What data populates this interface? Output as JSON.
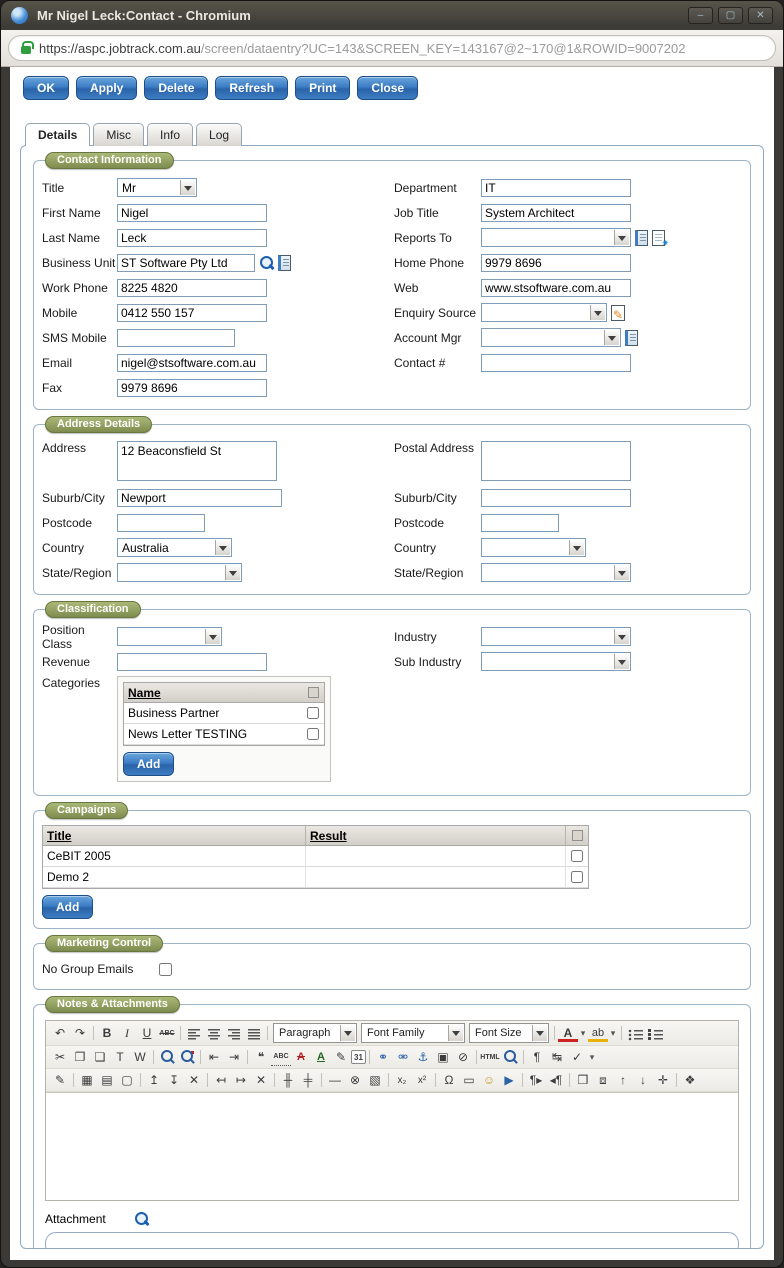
{
  "colors": {
    "button_blue": "#2f6cb0",
    "legend_green": "#7d8c4f",
    "padlock_green": "#2e9e3f",
    "icon_blue": "#1b5fae"
  },
  "titlebar": {
    "title": "Mr Nigel Leck:Contact - Chromium",
    "controls": {
      "minimize": "–",
      "maximize": "▢",
      "close": "✕"
    }
  },
  "urlbar": {
    "host": "https://aspc.jobtrack.com.au",
    "path": "/screen/dataentry?UC=143&SCREEN_KEY=143167@2~170@1&ROWID=9007202"
  },
  "actions": [
    "OK",
    "Apply",
    "Delete",
    "Refresh",
    "Print",
    "Close"
  ],
  "tabs": [
    "Details",
    "Misc",
    "Info",
    "Log"
  ],
  "contact": {
    "legend": "Contact Information",
    "left": [
      {
        "label": "Title",
        "value": "Mr"
      },
      {
        "label": "First Name",
        "value": "Nigel"
      },
      {
        "label": "Last Name",
        "value": "Leck"
      },
      {
        "label": "Business Unit",
        "value": "ST Software Pty Ltd",
        "icons": [
          "search",
          "ledger"
        ]
      },
      {
        "label": "Work Phone",
        "value": "8225 4820"
      },
      {
        "label": "Mobile",
        "value": "0412 550 157"
      },
      {
        "label": "SMS Mobile",
        "value": ""
      },
      {
        "label": "Email",
        "value": "nigel@stsoftware.com.au"
      },
      {
        "label": "Fax",
        "value": "9979 8696"
      }
    ],
    "right": [
      {
        "label": "Department",
        "value": "IT"
      },
      {
        "label": "Job Title",
        "value": "System Architect"
      },
      {
        "label": "Reports To",
        "value": "",
        "icons": [
          "ledger",
          "new-record"
        ]
      },
      {
        "label": "Home Phone",
        "value": "9979 8696"
      },
      {
        "label": "Web",
        "value": "www.stsoftware.com.au"
      },
      {
        "label": "Enquiry Source",
        "value": "",
        "icons": [
          "edit"
        ]
      },
      {
        "label": "Account Mgr",
        "value": "",
        "icons": [
          "ledger"
        ]
      },
      {
        "label": "Contact #",
        "value": ""
      }
    ]
  },
  "address": {
    "legend": "Address Details",
    "left": [
      {
        "label": "Address",
        "value": "12 Beaconsfield St"
      },
      {
        "label": "Suburb/City",
        "value": "Newport"
      },
      {
        "label": "Postcode",
        "value": ""
      },
      {
        "label": "Country",
        "value": "Australia"
      },
      {
        "label": "State/Region",
        "value": ""
      }
    ],
    "right": [
      {
        "label": "Postal Address",
        "value": ""
      },
      {
        "label": "Suburb/City",
        "value": ""
      },
      {
        "label": "Postcode",
        "value": ""
      },
      {
        "label": "Country",
        "value": ""
      },
      {
        "label": "State/Region",
        "value": ""
      }
    ]
  },
  "classification": {
    "legend": "Classification",
    "position_class": {
      "label": "Position Class",
      "value": ""
    },
    "revenue": {
      "label": "Revenue",
      "value": ""
    },
    "industry": {
      "label": "Industry",
      "value": ""
    },
    "sub_industry": {
      "label": "Sub Industry",
      "value": ""
    },
    "categories": {
      "label": "Categories",
      "column": "Name",
      "rows": [
        "Business Partner",
        "News Letter TESTING"
      ],
      "add_label": "Add"
    }
  },
  "campaigns": {
    "legend": "Campaigns",
    "columns": {
      "title": "Title",
      "result": "Result"
    },
    "rows": [
      {
        "title": "CeBIT 2005",
        "result": ""
      },
      {
        "title": "Demo 2",
        "result": ""
      }
    ],
    "add_label": "Add"
  },
  "marketing": {
    "legend": "Marketing Control",
    "no_group_emails_label": "No Group Emails"
  },
  "notes": {
    "legend": "Notes & Attachments",
    "attachment_label": "Attachment",
    "selects": {
      "format": "Paragraph",
      "font_family": "Font Family",
      "font_size": "Font Size"
    },
    "toolbar_row1a": [
      {
        "name": "undo-icon",
        "glyph": "↶"
      },
      {
        "name": "redo-icon",
        "glyph": "↷"
      },
      {
        "name": "toolbar-separator",
        "glyph": ""
      },
      {
        "name": "bold-icon",
        "glyph": "B"
      },
      {
        "name": "italic-icon",
        "glyph": "I"
      },
      {
        "name": "underline-icon",
        "glyph": "U"
      },
      {
        "name": "strikethrough-icon",
        "glyph": "ABC"
      },
      {
        "name": "toolbar-separator",
        "glyph": ""
      },
      {
        "name": "align-left-icon",
        "glyph": ""
      },
      {
        "name": "align-center-icon",
        "glyph": ""
      },
      {
        "name": "align-right-icon",
        "glyph": ""
      },
      {
        "name": "align-justify-icon",
        "glyph": ""
      },
      {
        "name": "toolbar-separator",
        "glyph": ""
      }
    ],
    "toolbar_row1b": [
      {
        "name": "toolbar-separator",
        "glyph": ""
      },
      {
        "name": "forecolor-icon",
        "glyph": "A"
      },
      {
        "name": "forecolor-menu-icon",
        "glyph": "▾"
      },
      {
        "name": "backcolor-icon",
        "glyph": "ab"
      },
      {
        "name": "backcolor-menu-icon",
        "glyph": "▾"
      },
      {
        "name": "toolbar-separator",
        "glyph": ""
      },
      {
        "name": "unordered-list-icon",
        "glyph": ""
      },
      {
        "name": "ordered-list-icon",
        "glyph": ""
      }
    ],
    "toolbar_row2": [
      {
        "name": "cut-icon",
        "glyph": "✂"
      },
      {
        "name": "copy-icon",
        "glyph": "❐"
      },
      {
        "name": "paste-icon",
        "glyph": "❏"
      },
      {
        "name": "paste-as-text-icon",
        "glyph": "T"
      },
      {
        "name": "paste-from-word-icon",
        "glyph": "W"
      },
      {
        "name": "toolbar-separator",
        "glyph": ""
      },
      {
        "name": "find-icon",
        "glyph": ""
      },
      {
        "name": "find-replace-icon",
        "glyph": ""
      },
      {
        "name": "toolbar-separator",
        "glyph": ""
      },
      {
        "name": "outdent-icon",
        "glyph": "⇤"
      },
      {
        "name": "indent-icon",
        "glyph": "⇥"
      },
      {
        "name": "toolbar-separator",
        "glyph": ""
      },
      {
        "name": "blockquote-icon",
        "glyph": "❝"
      },
      {
        "name": "abbreviation-icon",
        "glyph": "ABC"
      },
      {
        "name": "del-icon",
        "glyph": "A"
      },
      {
        "name": "ins-icon",
        "glyph": "A"
      },
      {
        "name": "attributes-icon",
        "glyph": "✎"
      },
      {
        "name": "insert-date-icon",
        "glyph": "31"
      },
      {
        "name": "toolbar-separator",
        "glyph": ""
      },
      {
        "name": "link-icon",
        "glyph": "⚭"
      },
      {
        "name": "unlink-icon",
        "glyph": "⚮"
      },
      {
        "name": "anchor-icon",
        "glyph": "⚓"
      },
      {
        "name": "image-icon",
        "glyph": "▣"
      },
      {
        "name": "cleanup-icon",
        "glyph": "⊘"
      },
      {
        "name": "toolbar-separator",
        "glyph": ""
      },
      {
        "name": "html-source-icon",
        "glyph": "HTML"
      },
      {
        "name": "preview-icon",
        "glyph": ""
      },
      {
        "name": "toolbar-separator",
        "glyph": ""
      },
      {
        "name": "visual-chars-icon",
        "glyph": "¶"
      },
      {
        "name": "page-break-icon",
        "glyph": "↹"
      },
      {
        "name": "spellcheck-icon",
        "glyph": "✓"
      },
      {
        "name": "toolbar-toggle-icon",
        "glyph": "▾"
      }
    ],
    "toolbar_row3": [
      {
        "name": "new-document-icon",
        "glyph": "✎"
      },
      {
        "name": "toolbar-separator",
        "glyph": ""
      },
      {
        "name": "insert-table-icon",
        "glyph": "▦"
      },
      {
        "name": "table-properties-icon",
        "glyph": "▤"
      },
      {
        "name": "cell-properties-icon",
        "glyph": "▢"
      },
      {
        "name": "toolbar-separator",
        "glyph": ""
      },
      {
        "name": "row-before-icon",
        "glyph": "↥"
      },
      {
        "name": "row-after-icon",
        "glyph": "↧"
      },
      {
        "name": "delete-row-icon",
        "glyph": "✕"
      },
      {
        "name": "toolbar-separator",
        "glyph": ""
      },
      {
        "name": "col-before-icon",
        "glyph": "↤"
      },
      {
        "name": "col-after-icon",
        "glyph": "↦"
      },
      {
        "name": "delete-col-icon",
        "glyph": "✕"
      },
      {
        "name": "toolbar-separator",
        "glyph": ""
      },
      {
        "name": "split-cells-icon",
        "glyph": "╫"
      },
      {
        "name": "merge-cells-icon",
        "glyph": "╪"
      },
      {
        "name": "toolbar-separator",
        "glyph": ""
      },
      {
        "name": "horizontal-rule-icon",
        "glyph": "—"
      },
      {
        "name": "remove-format-icon",
        "glyph": "⊗"
      },
      {
        "name": "visual-aid-icon",
        "glyph": "▧"
      },
      {
        "name": "toolbar-separator",
        "glyph": ""
      },
      {
        "name": "subscript-icon",
        "glyph": "x₂"
      },
      {
        "name": "superscript-icon",
        "glyph": "x²"
      },
      {
        "name": "toolbar-separator",
        "glyph": ""
      },
      {
        "name": "charmap-icon",
        "glyph": "Ω"
      },
      {
        "name": "iframe-icon",
        "glyph": "▭"
      },
      {
        "name": "emotions-icon",
        "glyph": "☺"
      },
      {
        "name": "media-icon",
        "glyph": "▶"
      },
      {
        "name": "toolbar-separator",
        "glyph": ""
      },
      {
        "name": "ltr-icon",
        "glyph": "¶▸"
      },
      {
        "name": "rtl-icon",
        "glyph": "◂¶"
      },
      {
        "name": "toolbar-separator",
        "glyph": ""
      },
      {
        "name": "fullscreen-icon",
        "glyph": "❒"
      },
      {
        "name": "insert-layer-icon",
        "glyph": "⧈"
      },
      {
        "name": "move-forward-icon",
        "glyph": "↑"
      },
      {
        "name": "move-backward-icon",
        "glyph": "↓"
      },
      {
        "name": "absolute-position-icon",
        "glyph": "✛"
      },
      {
        "name": "toolbar-separator",
        "glyph": ""
      },
      {
        "name": "style-props-icon",
        "glyph": "❖"
      }
    ]
  }
}
